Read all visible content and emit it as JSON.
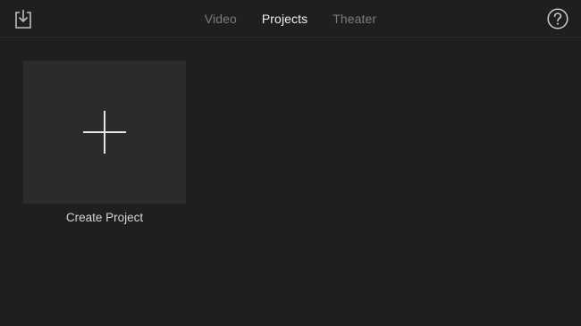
{
  "header": {
    "tabs": [
      {
        "label": "Video",
        "active": false
      },
      {
        "label": "Projects",
        "active": true
      },
      {
        "label": "Theater",
        "active": false
      }
    ],
    "left_icon": "import-icon",
    "right_icon": "help-icon"
  },
  "main": {
    "create_tile": {
      "icon": "plus-icon",
      "label": "Create Project"
    }
  },
  "colors": {
    "background": "#1f1f1f",
    "tile": "#2b2b2b",
    "tab_active": "#f2f2f2",
    "tab_inactive": "#7d7d7d"
  }
}
